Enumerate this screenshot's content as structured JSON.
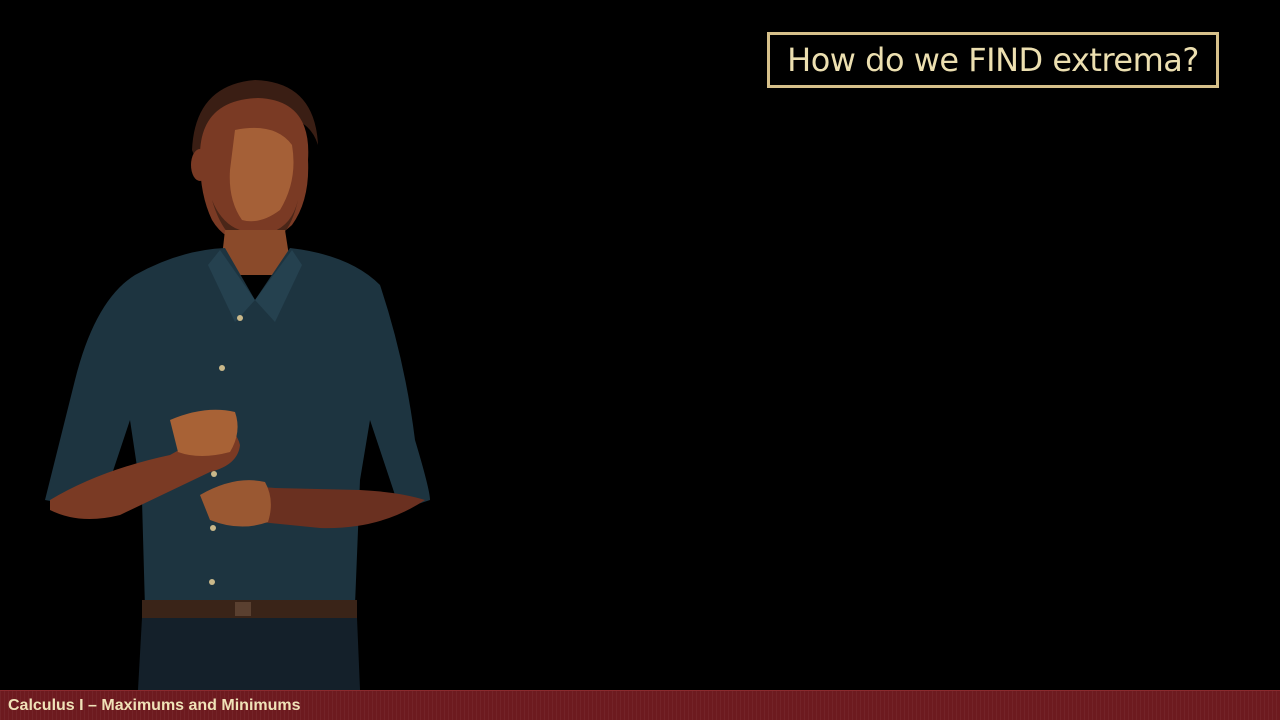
{
  "slide": {
    "title": "How do we FIND extrema?",
    "footer_text": "Calculus I – Maximums and Minimums"
  },
  "colors": {
    "background": "#000000",
    "title_border": "#d6c08a",
    "title_text": "#ecdfb0",
    "footer_background": "#6d1a1f",
    "footer_text": "#f0e2b8",
    "shirt": "#1d3440"
  }
}
